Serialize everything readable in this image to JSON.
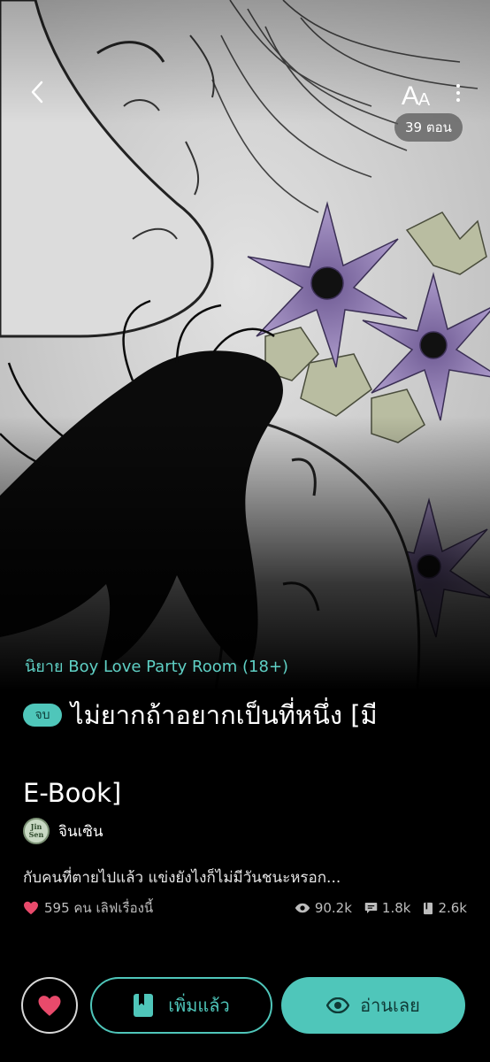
{
  "header": {
    "font_size_button": {
      "big": "A",
      "small": "A"
    },
    "episode_count": "39 ตอน"
  },
  "story": {
    "category": "นิยาย Boy Love Party Room (18+)",
    "status_badge": "จบ",
    "title_line1": "ไม่ยากถ้าอยากเป็นที่หนึ่ง [มี",
    "title_line2": "E-Book]",
    "author": {
      "avatar_line1": "Jin",
      "avatar_line2": "Sen",
      "name": "จินเซิน"
    },
    "synopsis": "กับคนที่ตายไปแล้ว แข่งยังไงก็ไม่มีวันชนะหรอก..."
  },
  "stats": {
    "likes": "595 คน เลิฟเรื่องนี้",
    "views": "90.2k",
    "comments": "1.8k",
    "library": "2.6k"
  },
  "actions": {
    "added_label": "เพิ่มแล้ว",
    "read_label": "อ่านเลย"
  },
  "colors": {
    "accent": "#4fc6ba",
    "accent_text": "#5fd0c5",
    "heart": "#e84a6b",
    "background": "#000000"
  },
  "icons": [
    "chevron-left-icon",
    "font-size-icon",
    "more-vertical-icon",
    "heart-icon",
    "eye-icon",
    "comment-icon",
    "book-icon"
  ]
}
